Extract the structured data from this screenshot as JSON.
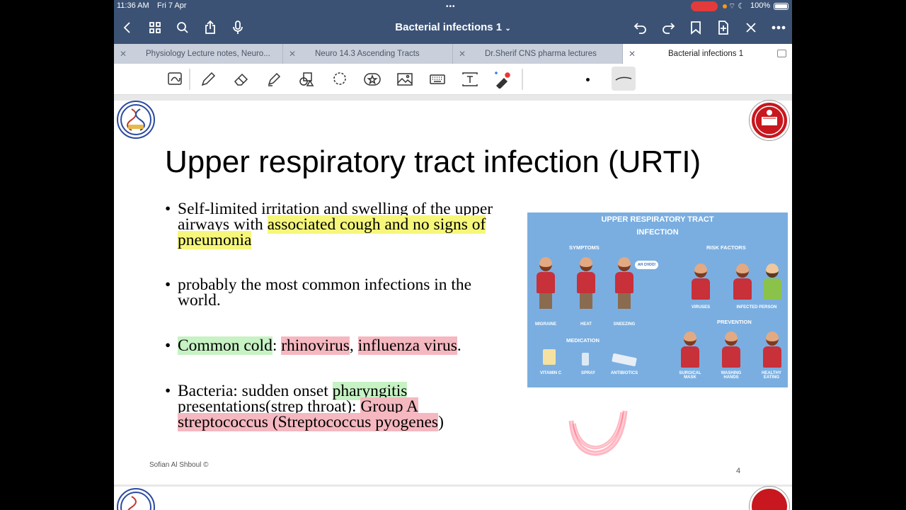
{
  "status_bar": {
    "time": "11:36 AM",
    "date": "Fri 7 Apr",
    "battery": "100%"
  },
  "nav": {
    "document_title": "Bacterial infections 1",
    "icons": [
      "back-icon",
      "grid-icon",
      "search-icon",
      "share-icon",
      "microphone-icon",
      "undo-icon",
      "redo-icon",
      "bookmark-icon",
      "add-page-icon",
      "close-pen-icon",
      "more-icon"
    ]
  },
  "tabs": [
    {
      "label": "Physiology Lecture notes, Neuro...",
      "active": false
    },
    {
      "label": "Neuro 14.3 Ascending Tracts",
      "active": false
    },
    {
      "label": "Dr.Sherif CNS pharma lectures",
      "active": false
    },
    {
      "label": "Bacterial infections 1",
      "active": true
    }
  ],
  "toolbar": {
    "tools": [
      "lasso-select-icon",
      "pen-icon",
      "eraser-icon",
      "highlighter-icon",
      "shapes-icon",
      "lasso-icon",
      "sticker-icon",
      "image-icon",
      "keyboard-icon",
      "text-icon",
      "laser-pointer-icon"
    ]
  },
  "slide": {
    "title": "Upper respiratory tract infection (URTI)",
    "bullets": [
      {
        "parts": [
          {
            "text": "Self-limited irritation and swelling of the upper airways with ",
            "hl": ""
          },
          {
            "text": "associated cough and no signs of pneumonia",
            "hl": "y"
          }
        ]
      },
      {
        "parts": [
          {
            "text": "probably the most common infections in the world.",
            "hl": ""
          }
        ]
      },
      {
        "parts": [
          {
            "text": "Common cold",
            "hl": "g"
          },
          {
            "text": ": ",
            "hl": ""
          },
          {
            "text": "rhinovirus",
            "hl": "r"
          },
          {
            "text": ", ",
            "hl": ""
          },
          {
            "text": "influenza virus",
            "hl": "r"
          },
          {
            "text": ".",
            "hl": ""
          }
        ]
      },
      {
        "parts": [
          {
            "text": "Bacteria: sudden onset ",
            "hl": ""
          },
          {
            "text": "pharyngitis",
            "hl": "g"
          },
          {
            "text": " presentations(strep throat): ",
            "hl": ""
          },
          {
            "text": "Group A streptococcus (Streptococcus pyogenes",
            "hl": "r"
          },
          {
            "text": ")",
            "hl": ""
          }
        ]
      }
    ],
    "credit": "Sofian Al Shboul ©",
    "page_number": "4"
  },
  "infographic": {
    "title_line1": "UPPER RESPIRATORY TRACT",
    "title_line2": "INFECTION",
    "sections": {
      "symptoms": "SYMPTOMS",
      "risk_factors": "RISK FACTORS",
      "medication": "MEDICATION",
      "prevention": "PREVENTION"
    },
    "speech": "AH CHOO!",
    "labels": {
      "migraine": "MIGRAINE",
      "heat": "HEAT",
      "sneezing": "SNEEZING",
      "viruses": "VIRUSES",
      "infected_person": "INFECTED PERSON",
      "vitamin_c": "VITAMIN C",
      "spray": "SPRAY",
      "antibiotics": "ANTIBIOTICS",
      "surgical_mask": "SURGICAL MASK",
      "washing_hands": "WASHING HANDS",
      "healthy_eating": "HEALTHY EATING"
    }
  },
  "colors": {
    "nav_bg": "#3b5275",
    "tab_bg": "#c9d0db",
    "infographic_bg": "#7aaee0",
    "highlight_yellow": "#f6f77a",
    "highlight_green": "#c7f2c4",
    "highlight_red": "#f5b8c0",
    "annotation_neon": "#ff2a4d"
  }
}
